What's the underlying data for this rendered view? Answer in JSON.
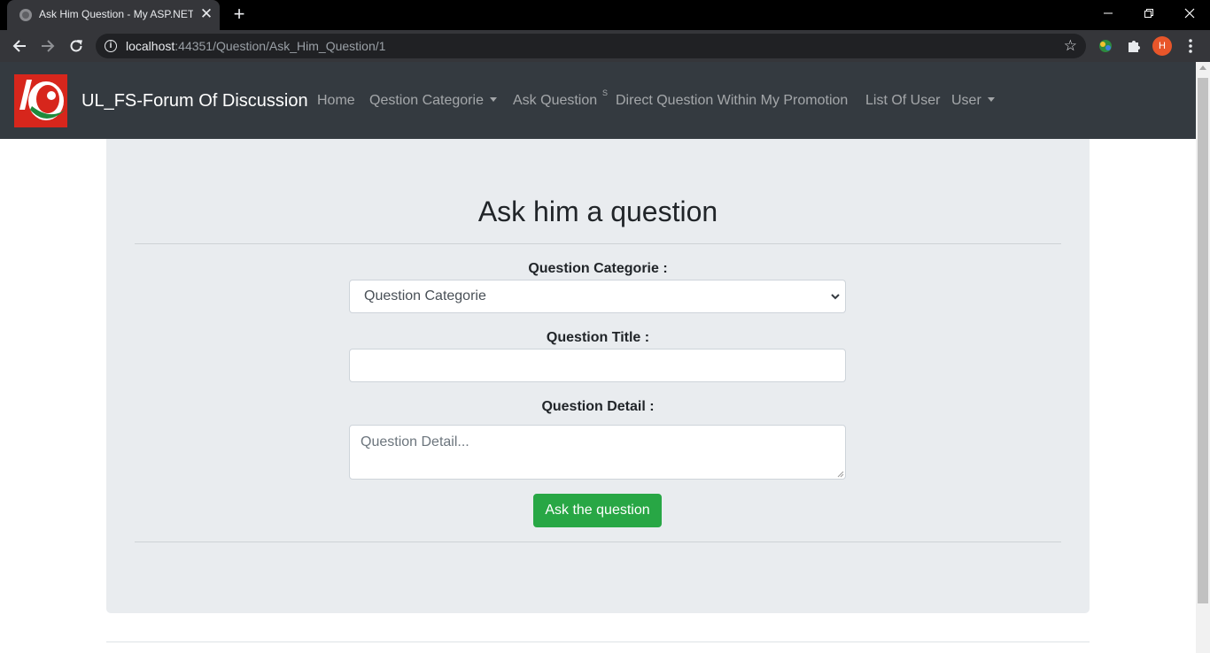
{
  "browser": {
    "tab_title": "Ask Him Question - My ASP.NET",
    "tab_close": "✕",
    "new_tab": "+",
    "url_host": "localhost",
    "url_rest": ":44351/Question/Ask_Him_Question/1",
    "profile_initial": "H"
  },
  "site": {
    "brand": "UL_FS-Forum Of Discussion",
    "nav": {
      "home": "Home",
      "categories": "Qestion Categorie",
      "ask": "Ask Question",
      "marker": "S",
      "direct": "Direct Question Within My Promotion",
      "users": "List Of User",
      "user": "User"
    }
  },
  "page": {
    "title": "Ask him a question",
    "category_label": "Question Categorie :",
    "category_selected": "Question Categorie",
    "title_label": "Question Title :",
    "title_value": "",
    "detail_label": "Question Detail :",
    "detail_placeholder": "Question Detail...",
    "submit_label": "Ask the question"
  },
  "colors": {
    "navbar": "#343a40",
    "jumbotron": "#e9ecef",
    "button": "#28a745",
    "logo_red": "#d7261c"
  }
}
